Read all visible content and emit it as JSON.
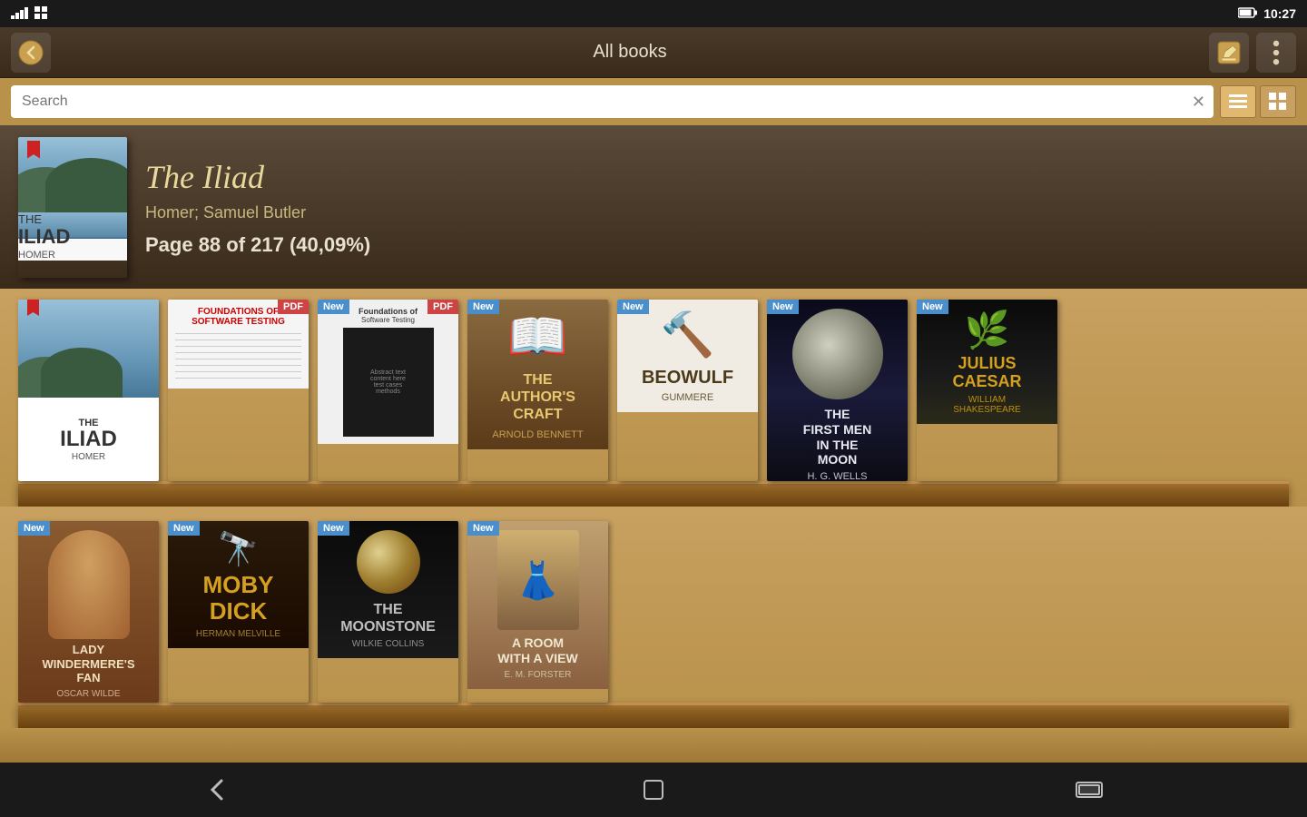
{
  "statusBar": {
    "time": "10:27",
    "batteryIcon": "🔋",
    "icons": [
      "📶",
      "🔋"
    ]
  },
  "topBar": {
    "title": "All books",
    "backIcon": "↩",
    "editIcon": "✏",
    "menuIcon": "⋮"
  },
  "search": {
    "placeholder": "Search",
    "clearIcon": "✕"
  },
  "viewToggle": {
    "listView": "≡",
    "gridView": "⊞"
  },
  "featured": {
    "title": "The Iliad",
    "author": "Homer; Samuel Butler",
    "progress": "Page 88 of 217 (40,09%)"
  },
  "shelf1": {
    "books": [
      {
        "title": "THE ILIAD",
        "subtitle": "THE",
        "author": "HOMER",
        "badge": null,
        "cover": "iliad"
      },
      {
        "title": "FOUNDATIONS OF SOFTWARE TESTING",
        "author": "",
        "badge": "PDF",
        "cover": "foundations"
      },
      {
        "title": "",
        "author": "",
        "badge": "New+PDF",
        "cover": "testing"
      },
      {
        "title": "THE AUTHOR'S CRAFT",
        "author": "ARNOLD BENNETT",
        "badge": "New",
        "cover": "authors-craft"
      },
      {
        "title": "BEOWULF",
        "author": "GUMMERE",
        "badge": "New",
        "cover": "beowulf"
      },
      {
        "title": "THE FIRST MEN IN THE MOON",
        "author": "H. G. WELLS",
        "badge": "New",
        "cover": "first-men"
      },
      {
        "title": "JULIUS CAESAR",
        "author": "WILLIAM SHAKESPEARE",
        "badge": "New",
        "cover": "julius"
      }
    ]
  },
  "shelf2": {
    "books": [
      {
        "title": "LADY WINDERMERE'S FAN",
        "author": "OSCAR WILDE",
        "badge": "New",
        "cover": "lady"
      },
      {
        "title": "MOBY DICK",
        "author": "HERMAN MELVILLE",
        "badge": "New",
        "cover": "moby"
      },
      {
        "title": "THE MOONSTONE",
        "author": "WILKIE COLLINS",
        "badge": "New",
        "cover": "moonstone"
      },
      {
        "title": "A ROOM WITH A VIEW",
        "author": "E. M. FORSTER",
        "badge": "New",
        "cover": "room"
      }
    ]
  },
  "navBar": {
    "backIcon": "←",
    "homeIcon": "⌂",
    "recentIcon": "▭"
  }
}
